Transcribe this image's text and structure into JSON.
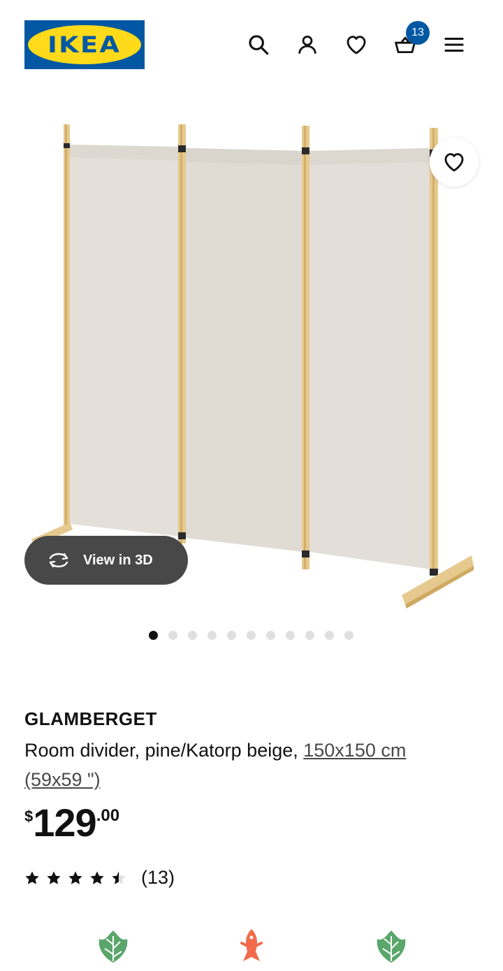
{
  "header": {
    "logo_text": "IKEA",
    "logo_reg": "®",
    "icons": [
      "search-icon",
      "user-icon",
      "heart-icon",
      "cart-icon",
      "menu-icon"
    ],
    "cart_count": "13",
    "colors": {
      "brand_blue": "#0058a3",
      "brand_yellow": "#ffda1a"
    }
  },
  "gallery": {
    "view_3d_label": "View in 3D",
    "image_count": 11,
    "active_index": 0
  },
  "product": {
    "name": "GLAMBERGET",
    "description": "Room divider, pine/Katorp beige, ",
    "size_text": "150x150 cm",
    "size_imperial": "(59x59 \")",
    "price_currency": "$",
    "price_integer": "129",
    "price_decimal": ".00",
    "rating_value": 4.5,
    "rating_max": 5,
    "review_count": "(13)"
  },
  "badges": [
    "leaf-icon",
    "fish-icon",
    "leaf-icon"
  ]
}
